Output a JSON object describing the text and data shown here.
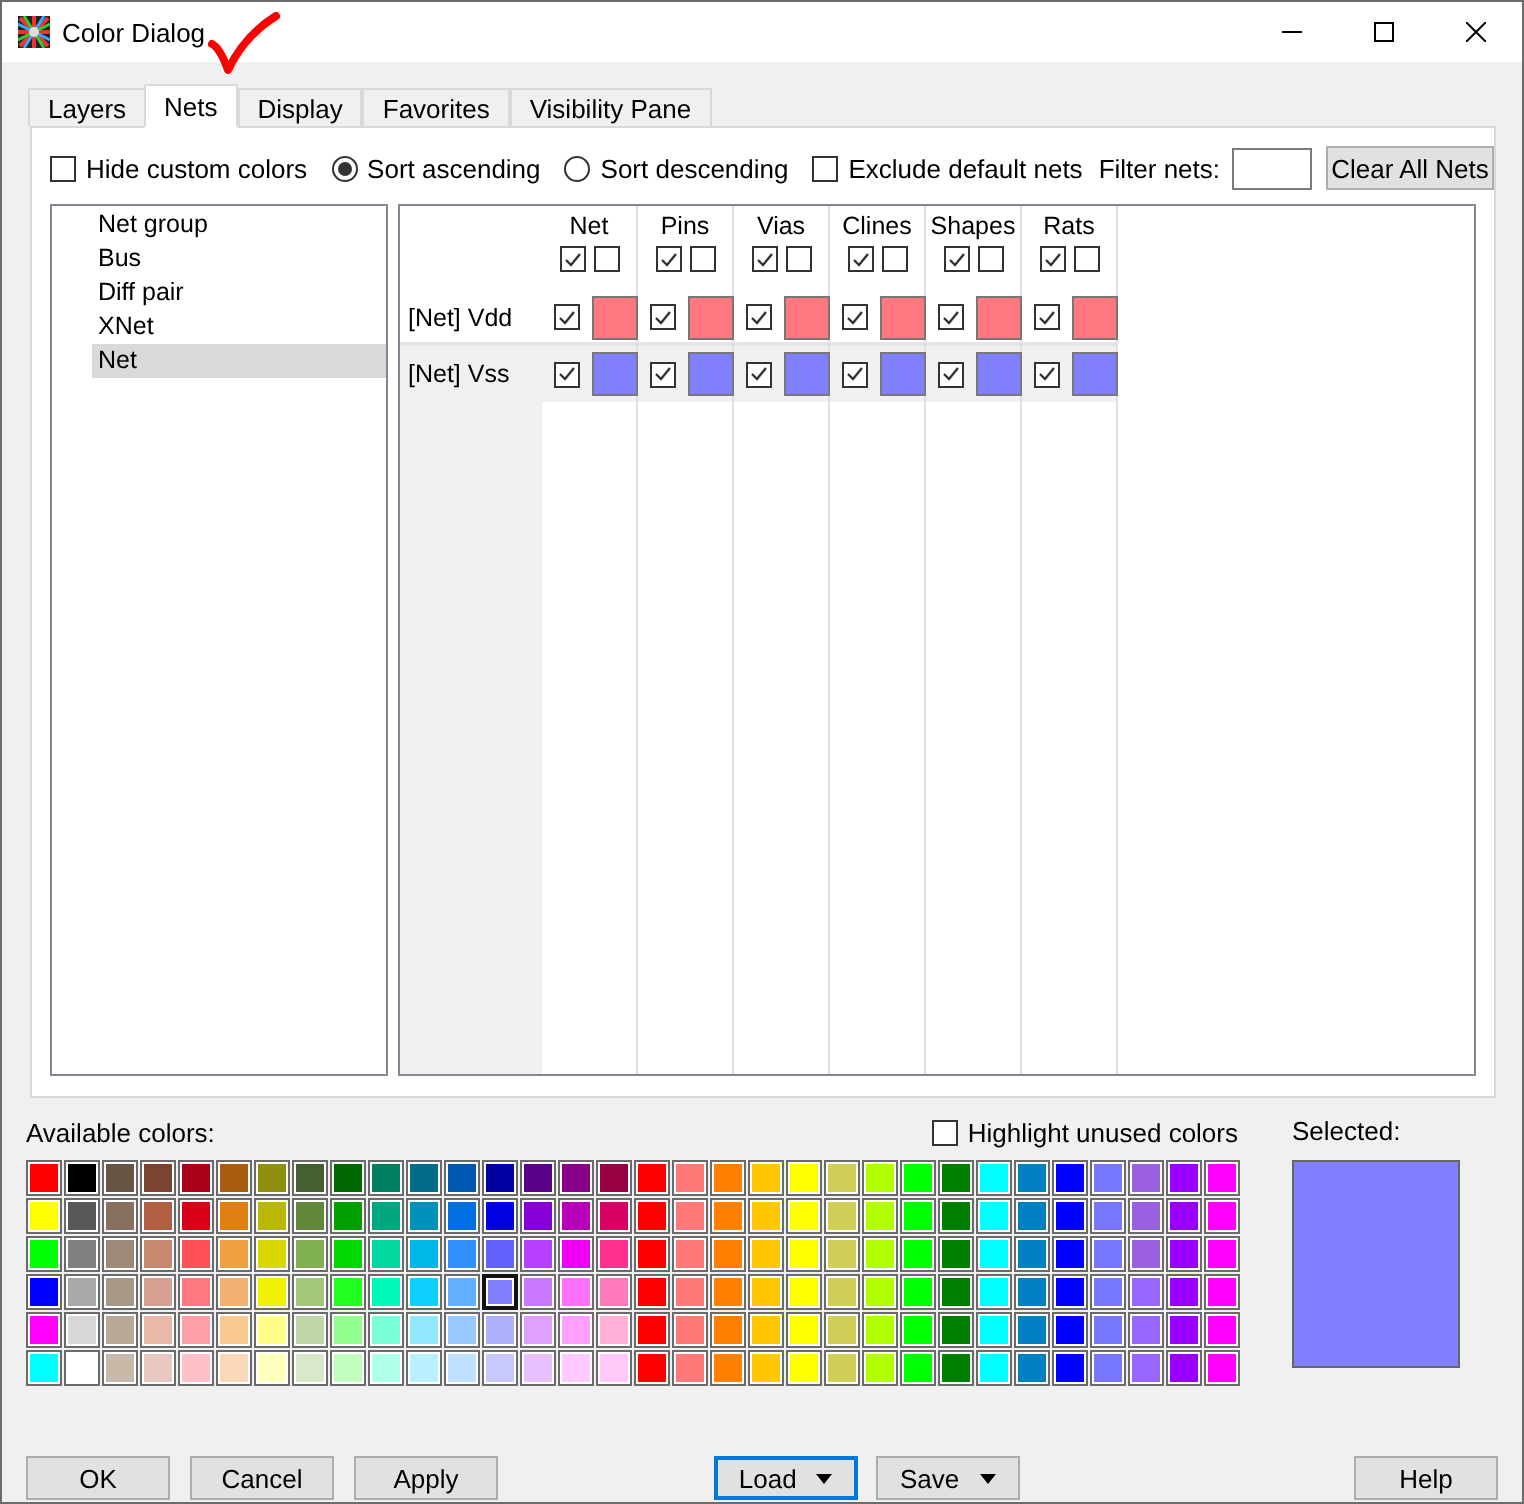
{
  "window": {
    "title": "Color Dialog"
  },
  "tabs": [
    {
      "label": "Layers",
      "selected": false
    },
    {
      "label": "Nets",
      "selected": true
    },
    {
      "label": "Display",
      "selected": false
    },
    {
      "label": "Favorites",
      "selected": false
    },
    {
      "label": "Visibility Pane",
      "selected": false
    }
  ],
  "options": [
    {
      "kind": "checkbox",
      "label": "Hide custom colors",
      "checked": false
    },
    {
      "kind": "radio",
      "label": "Sort ascending",
      "selected": true
    },
    {
      "kind": "radio",
      "label": "Sort descending",
      "selected": false
    },
    {
      "kind": "checkbox",
      "label": "Exclude default nets",
      "checked": false
    }
  ],
  "filter": {
    "label": "Filter nets:"
  },
  "clear_button": "Clear All Nets",
  "net_types": [
    {
      "label": "Net group",
      "selected": false
    },
    {
      "label": "Bus",
      "selected": false
    },
    {
      "label": "Diff pair",
      "selected": false
    },
    {
      "label": "XNet",
      "selected": false
    },
    {
      "label": "Net",
      "selected": true
    }
  ],
  "grid": {
    "columns": [
      {
        "label": "Net",
        "checks": [
          true,
          false
        ]
      },
      {
        "label": "Pins",
        "checks": [
          true,
          false
        ]
      },
      {
        "label": "Vias",
        "checks": [
          true,
          false
        ]
      },
      {
        "label": "Clines",
        "checks": [
          true,
          false
        ]
      },
      {
        "label": "Shapes",
        "checks": [
          true,
          false
        ]
      },
      {
        "label": "Rats",
        "checks": [
          true,
          false
        ]
      }
    ],
    "rows": [
      {
        "label": "[Net] Vdd",
        "cells": [
          {
            "checked": true,
            "color": "#ff7880"
          },
          {
            "checked": true,
            "color": "#ff7880"
          },
          {
            "checked": true,
            "color": "#ff7880"
          },
          {
            "checked": true,
            "color": "#ff7880"
          },
          {
            "checked": true,
            "color": "#ff7880"
          },
          {
            "checked": true,
            "color": "#ff7880"
          }
        ]
      },
      {
        "label": "[Net] Vss",
        "cells": [
          {
            "checked": true,
            "color": "#8080ff"
          },
          {
            "checked": true,
            "color": "#8080ff"
          },
          {
            "checked": true,
            "color": "#8080ff"
          },
          {
            "checked": true,
            "color": "#8080ff"
          },
          {
            "checked": true,
            "color": "#8080ff"
          },
          {
            "checked": true,
            "color": "#8080ff"
          }
        ]
      }
    ]
  },
  "palette": {
    "label": "Available colors:",
    "rows": [
      {
        "cells": [
          {
            "color": "#ff0000",
            "selected": false
          },
          {
            "color": "#000000",
            "selected": false
          },
          {
            "color": "#665544",
            "selected": false
          },
          {
            "color": "#7a4430",
            "selected": false
          },
          {
            "color": "#aa0018",
            "selected": false
          },
          {
            "color": "#a85c10",
            "selected": false
          },
          {
            "color": "#909010",
            "selected": false
          },
          {
            "color": "#446030",
            "selected": false
          },
          {
            "color": "#006800",
            "selected": false
          },
          {
            "color": "#008060",
            "selected": false
          },
          {
            "color": "#006c88",
            "selected": false
          },
          {
            "color": "#0058b0",
            "selected": false
          },
          {
            "color": "#0000a0",
            "selected": false
          },
          {
            "color": "#580088",
            "selected": false
          },
          {
            "color": "#880088",
            "selected": false
          },
          {
            "color": "#980044",
            "selected": false
          },
          {
            "color": "#ff0000",
            "selected": false
          },
          {
            "color": "#ff7878",
            "selected": false
          },
          {
            "color": "#ff8000",
            "selected": false
          },
          {
            "color": "#ffc800",
            "selected": false
          },
          {
            "color": "#ffff00",
            "selected": false
          },
          {
            "color": "#d0d058",
            "selected": false
          },
          {
            "color": "#b0ff00",
            "selected": false
          },
          {
            "color": "#00ff00",
            "selected": false
          },
          {
            "color": "#008000",
            "selected": false
          },
          {
            "color": "#00ffff",
            "selected": false
          },
          {
            "color": "#0080c0",
            "selected": false
          },
          {
            "color": "#0000ff",
            "selected": false
          },
          {
            "color": "#7878ff",
            "selected": false
          },
          {
            "color": "#9960e0",
            "selected": false
          },
          {
            "color": "#9900ff",
            "selected": false
          },
          {
            "color": "#ff00ff",
            "selected": false
          }
        ]
      },
      {
        "cells": [
          {
            "color": "#ffff00",
            "selected": false
          },
          {
            "color": "#585858",
            "selected": false
          },
          {
            "color": "#887060",
            "selected": false
          },
          {
            "color": "#b06040",
            "selected": false
          },
          {
            "color": "#d80018",
            "selected": false
          },
          {
            "color": "#e08010",
            "selected": false
          },
          {
            "color": "#b8b800",
            "selected": false
          },
          {
            "color": "#608838",
            "selected": false
          },
          {
            "color": "#00a000",
            "selected": false
          },
          {
            "color": "#00a880",
            "selected": false
          },
          {
            "color": "#0090b8",
            "selected": false
          },
          {
            "color": "#0070e0",
            "selected": false
          },
          {
            "color": "#0000e0",
            "selected": false
          },
          {
            "color": "#8800d8",
            "selected": false
          },
          {
            "color": "#b800b8",
            "selected": false
          },
          {
            "color": "#d80060",
            "selected": false
          },
          {
            "color": "#ff0000",
            "selected": false
          },
          {
            "color": "#ff7878",
            "selected": false
          },
          {
            "color": "#ff8000",
            "selected": false
          },
          {
            "color": "#ffc800",
            "selected": false
          },
          {
            "color": "#ffff00",
            "selected": false
          },
          {
            "color": "#d0d058",
            "selected": false
          },
          {
            "color": "#b0ff00",
            "selected": false
          },
          {
            "color": "#00ff00",
            "selected": false
          },
          {
            "color": "#008000",
            "selected": false
          },
          {
            "color": "#00ffff",
            "selected": false
          },
          {
            "color": "#0080c0",
            "selected": false
          },
          {
            "color": "#0000ff",
            "selected": false
          },
          {
            "color": "#7878ff",
            "selected": false
          },
          {
            "color": "#9960e0",
            "selected": false
          },
          {
            "color": "#9900ff",
            "selected": false
          },
          {
            "color": "#ff00ff",
            "selected": false
          }
        ]
      },
      {
        "cells": [
          {
            "color": "#00ff00",
            "selected": false
          },
          {
            "color": "#808080",
            "selected": false
          },
          {
            "color": "#a08878",
            "selected": false
          },
          {
            "color": "#c88870",
            "selected": false
          },
          {
            "color": "#ff5058",
            "selected": false
          },
          {
            "color": "#f0a040",
            "selected": false
          },
          {
            "color": "#d8d800",
            "selected": false
          },
          {
            "color": "#80b050",
            "selected": false
          },
          {
            "color": "#00d800",
            "selected": false
          },
          {
            "color": "#00d8a0",
            "selected": false
          },
          {
            "color": "#00b8e8",
            "selected": false
          },
          {
            "color": "#3090ff",
            "selected": false
          },
          {
            "color": "#6060ff",
            "selected": false
          },
          {
            "color": "#b840ff",
            "selected": false
          },
          {
            "color": "#f000f0",
            "selected": false
          },
          {
            "color": "#ff3090",
            "selected": false
          },
          {
            "color": "#ff0000",
            "selected": false
          },
          {
            "color": "#ff7878",
            "selected": false
          },
          {
            "color": "#ff8000",
            "selected": false
          },
          {
            "color": "#ffc800",
            "selected": false
          },
          {
            "color": "#ffff00",
            "selected": false
          },
          {
            "color": "#d0d058",
            "selected": false
          },
          {
            "color": "#b0ff00",
            "selected": false
          },
          {
            "color": "#00ff00",
            "selected": false
          },
          {
            "color": "#008000",
            "selected": false
          },
          {
            "color": "#00ffff",
            "selected": false
          },
          {
            "color": "#0080c0",
            "selected": false
          },
          {
            "color": "#0000ff",
            "selected": false
          },
          {
            "color": "#7878ff",
            "selected": false
          },
          {
            "color": "#9960e0",
            "selected": false
          },
          {
            "color": "#9900ff",
            "selected": false
          },
          {
            "color": "#ff00ff",
            "selected": false
          }
        ]
      },
      {
        "cells": [
          {
            "color": "#0000ff",
            "selected": false
          },
          {
            "color": "#a8a8a8",
            "selected": false
          },
          {
            "color": "#a89888",
            "selected": false
          },
          {
            "color": "#d8a090",
            "selected": false
          },
          {
            "color": "#ff7880",
            "selected": false
          },
          {
            "color": "#f0b070",
            "selected": false
          },
          {
            "color": "#f0f000",
            "selected": false
          },
          {
            "color": "#a0c878",
            "selected": false
          },
          {
            "color": "#20ff20",
            "selected": false
          },
          {
            "color": "#00f8b8",
            "selected": false
          },
          {
            "color": "#10d0ff",
            "selected": false
          },
          {
            "color": "#60b0ff",
            "selected": false
          },
          {
            "color": "#8080ff",
            "selected": true
          },
          {
            "color": "#c878ff",
            "selected": false
          },
          {
            "color": "#ff70ff",
            "selected": false
          },
          {
            "color": "#ff78b8",
            "selected": false
          },
          {
            "color": "#ff0000",
            "selected": false
          },
          {
            "color": "#ff7878",
            "selected": false
          },
          {
            "color": "#ff8000",
            "selected": false
          },
          {
            "color": "#ffc800",
            "selected": false
          },
          {
            "color": "#ffff00",
            "selected": false
          },
          {
            "color": "#d0d058",
            "selected": false
          },
          {
            "color": "#b0ff00",
            "selected": false
          },
          {
            "color": "#00ff00",
            "selected": false
          },
          {
            "color": "#008000",
            "selected": false
          },
          {
            "color": "#00ffff",
            "selected": false
          },
          {
            "color": "#0080c0",
            "selected": false
          },
          {
            "color": "#0000ff",
            "selected": false
          },
          {
            "color": "#7878ff",
            "selected": false
          },
          {
            "color": "#9966ff",
            "selected": false
          },
          {
            "color": "#9900ff",
            "selected": false
          },
          {
            "color": "#ff00ff",
            "selected": false
          }
        ]
      },
      {
        "cells": [
          {
            "color": "#ff00ff",
            "selected": false
          },
          {
            "color": "#d8d8d8",
            "selected": false
          },
          {
            "color": "#b8a898",
            "selected": false
          },
          {
            "color": "#e8b8a8",
            "selected": false
          },
          {
            "color": "#ffa0a8",
            "selected": false
          },
          {
            "color": "#f8c890",
            "selected": false
          },
          {
            "color": "#ffff88",
            "selected": false
          },
          {
            "color": "#c0d8a8",
            "selected": false
          },
          {
            "color": "#90ff90",
            "selected": false
          },
          {
            "color": "#78ffd8",
            "selected": false
          },
          {
            "color": "#90e8ff",
            "selected": false
          },
          {
            "color": "#98c8ff",
            "selected": false
          },
          {
            "color": "#b0b0ff",
            "selected": false
          },
          {
            "color": "#e0a0ff",
            "selected": false
          },
          {
            "color": "#ffa0ff",
            "selected": false
          },
          {
            "color": "#ffb0d8",
            "selected": false
          },
          {
            "color": "#ff0000",
            "selected": false
          },
          {
            "color": "#ff7878",
            "selected": false
          },
          {
            "color": "#ff8000",
            "selected": false
          },
          {
            "color": "#ffc800",
            "selected": false
          },
          {
            "color": "#ffff00",
            "selected": false
          },
          {
            "color": "#d0d058",
            "selected": false
          },
          {
            "color": "#b0ff00",
            "selected": false
          },
          {
            "color": "#00ff00",
            "selected": false
          },
          {
            "color": "#008000",
            "selected": false
          },
          {
            "color": "#00ffff",
            "selected": false
          },
          {
            "color": "#0080c0",
            "selected": false
          },
          {
            "color": "#0000ff",
            "selected": false
          },
          {
            "color": "#7878ff",
            "selected": false
          },
          {
            "color": "#9966ff",
            "selected": false
          },
          {
            "color": "#9900ff",
            "selected": false
          },
          {
            "color": "#ff00ff",
            "selected": false
          }
        ]
      },
      {
        "cells": [
          {
            "color": "#00ffff",
            "selected": false
          },
          {
            "color": "#ffffff",
            "selected": false
          },
          {
            "color": "#c8b8a8",
            "selected": false
          },
          {
            "color": "#e8c8c0",
            "selected": false
          },
          {
            "color": "#ffc0c8",
            "selected": false
          },
          {
            "color": "#f8d8b8",
            "selected": false
          },
          {
            "color": "#ffffc0",
            "selected": false
          },
          {
            "color": "#d8e8c8",
            "selected": false
          },
          {
            "color": "#c0ffc0",
            "selected": false
          },
          {
            "color": "#b0ffe8",
            "selected": false
          },
          {
            "color": "#b8f0ff",
            "selected": false
          },
          {
            "color": "#c0e0ff",
            "selected": false
          },
          {
            "color": "#c8c8ff",
            "selected": false
          },
          {
            "color": "#e8c0ff",
            "selected": false
          },
          {
            "color": "#ffc8ff",
            "selected": false
          },
          {
            "color": "#ffc8f8",
            "selected": false
          },
          {
            "color": "#ff0000",
            "selected": false
          },
          {
            "color": "#ff7878",
            "selected": false
          },
          {
            "color": "#ff8000",
            "selected": false
          },
          {
            "color": "#ffc800",
            "selected": false
          },
          {
            "color": "#ffff00",
            "selected": false
          },
          {
            "color": "#d0d058",
            "selected": false
          },
          {
            "color": "#b0ff00",
            "selected": false
          },
          {
            "color": "#00ff00",
            "selected": false
          },
          {
            "color": "#008000",
            "selected": false
          },
          {
            "color": "#00ffff",
            "selected": false
          },
          {
            "color": "#0080c0",
            "selected": false
          },
          {
            "color": "#0000ff",
            "selected": false
          },
          {
            "color": "#7878ff",
            "selected": false
          },
          {
            "color": "#9966ff",
            "selected": false
          },
          {
            "color": "#9900ff",
            "selected": false
          },
          {
            "color": "#ff00ff",
            "selected": false
          }
        ]
      }
    ]
  },
  "highlight_unused": {
    "label": "Highlight unused colors",
    "checked": false
  },
  "selected_swatch": {
    "label": "Selected:",
    "color": "#8080ff"
  },
  "buttons_left": [
    {
      "label": "OK",
      "kind": "plain",
      "focused": false
    },
    {
      "label": "Cancel",
      "kind": "plain",
      "focused": false
    },
    {
      "label": "Apply",
      "kind": "plain",
      "focused": false
    }
  ],
  "buttons_center": [
    {
      "label": "Load",
      "kind": "dropdown",
      "focused": true
    },
    {
      "label": "Save",
      "kind": "dropdown",
      "focused": false
    }
  ],
  "buttons_right": [
    {
      "label": "Help",
      "kind": "plain",
      "focused": false
    }
  ]
}
